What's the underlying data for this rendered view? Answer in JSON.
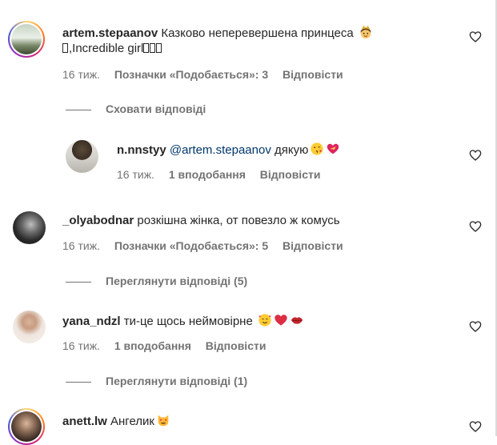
{
  "comments": [
    {
      "username": "artem.stepaanov",
      "text_line1": "Казково неперевершена принцеса",
      "text_line2": ",Incredible girl",
      "time": "16 тиж.",
      "likes": "Позначки «Подобається»: 3",
      "reply": "Відповісти",
      "toggle": "Сховати відповіді",
      "emoji": [
        "princess-emoji"
      ]
    },
    {
      "username": "n.nnstyy",
      "mention": "@artem.stepaanov",
      "text": "дякую",
      "time": "16 тиж.",
      "likes": "1 вподобання",
      "reply": "Відповісти",
      "emoji": [
        "kiss-face-emoji",
        "heart-ribbon-emoji"
      ]
    },
    {
      "username": "_olyabodnar",
      "text": "розкішна жінка, от повезло ж комусь",
      "time": "16 тиж.",
      "likes": "Позначки «Подобається»: 5",
      "reply": "Відповісти",
      "toggle": "Переглянути відповіді (5)"
    },
    {
      "username": "yana_ndzl",
      "text": "ти-це щось неймовірне",
      "time": "16 тиж.",
      "likes": "1 вподобання",
      "reply": "Відповісти",
      "toggle": "Переглянути відповіді (1)",
      "emoji": [
        "smiling-hearts-emoji",
        "red-heart-emoji",
        "lips-emoji"
      ]
    },
    {
      "username": "anett.lw",
      "text": "Ангелик",
      "emoji": [
        "cat-heart-eyes-emoji"
      ]
    }
  ],
  "colors": {
    "text": "#262626",
    "secondary": "#737373",
    "mention": "#00376b",
    "story_ring": "#d62976"
  }
}
